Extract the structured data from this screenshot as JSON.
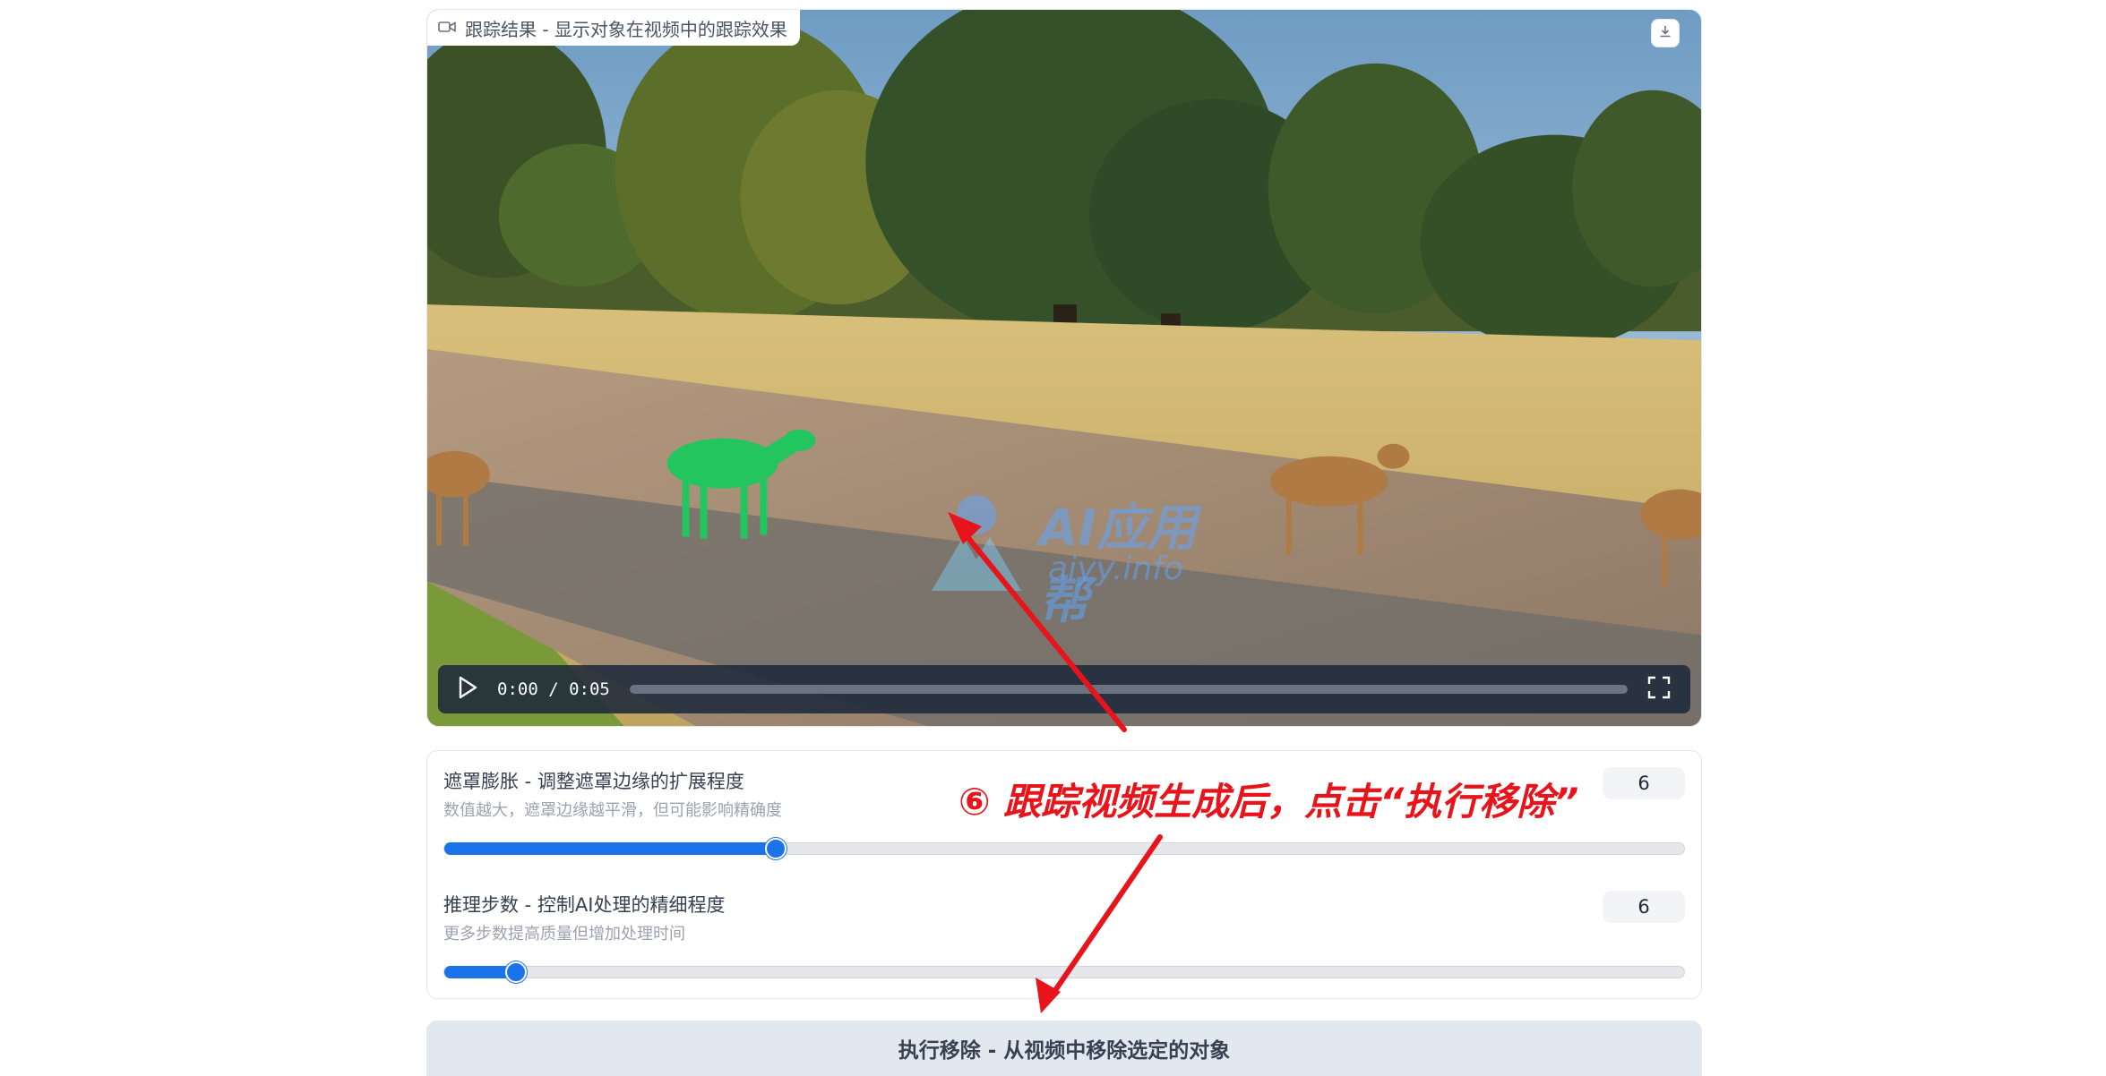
{
  "video": {
    "label": "跟踪结果 - 显示对象在视频中的跟踪效果",
    "time": "0:00 / 0:05",
    "progress": 0
  },
  "sliders": [
    {
      "title": "遮罩膨胀 - 调整遮罩边缘的扩展程度",
      "description": "数值越大，遮罩边缘越平滑，但可能影响精确度",
      "value": "6",
      "fill_fraction": 0.267
    },
    {
      "title": "推理步数 - 控制AI处理的精细程度",
      "description": "更多步数提高质量但增加处理时间",
      "value": "6",
      "fill_fraction": 0.058
    }
  ],
  "action": {
    "remove_label": "执行移除 - 从视频中移除选定的对象"
  },
  "annotation": {
    "text": "⑥ 跟踪视频生成后，点击“执行移除”"
  },
  "watermark": {
    "brand": "AI应用帮",
    "domain": "aiyy.info"
  },
  "colors": {
    "accent": "#1a73e8",
    "annotation": "#e8141c",
    "mask": "#22c55e"
  },
  "icons": {
    "video_label": "video-camera-icon",
    "download": "download-icon",
    "play": "play-icon",
    "fullscreen": "fullscreen-icon"
  }
}
